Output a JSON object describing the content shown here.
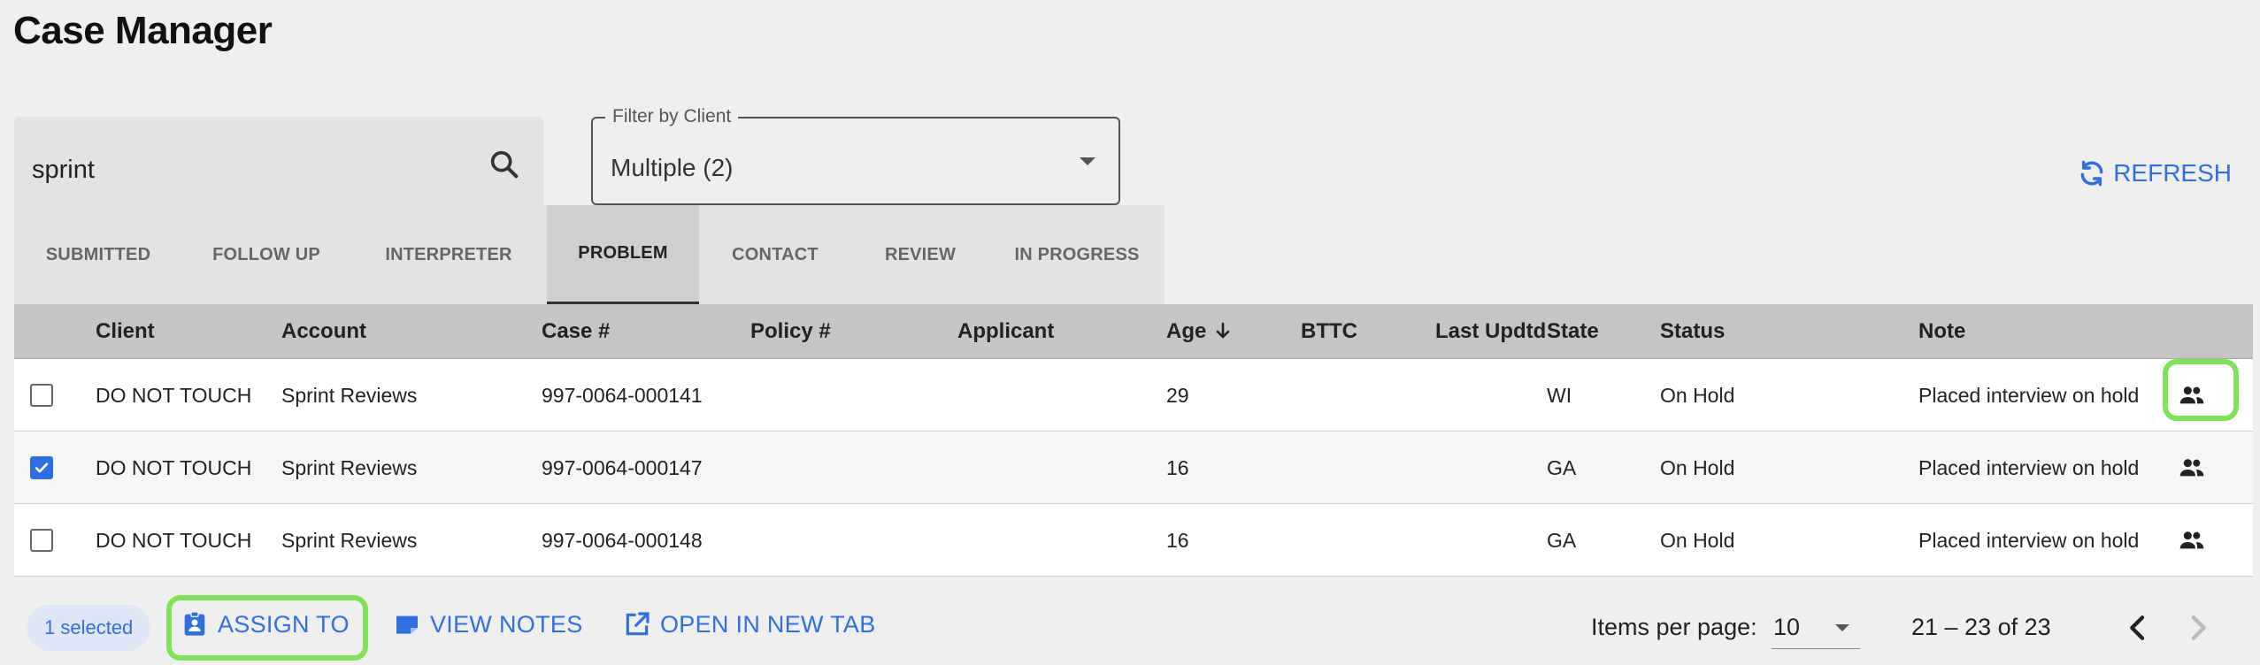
{
  "page": {
    "title": "Case Manager"
  },
  "search": {
    "value": "sprint",
    "placeholder": ""
  },
  "filter": {
    "label": "Filter by Client",
    "value": "Multiple (2)"
  },
  "refresh": {
    "label": "REFRESH"
  },
  "tabs": [
    {
      "label": "SUBMITTED",
      "active": false
    },
    {
      "label": "FOLLOW UP",
      "active": false
    },
    {
      "label": "INTERPRETER",
      "active": false
    },
    {
      "label": "PROBLEM",
      "active": true
    },
    {
      "label": "CONTACT",
      "active": false
    },
    {
      "label": "REVIEW",
      "active": false
    },
    {
      "label": "IN PROGRESS",
      "active": false
    }
  ],
  "table": {
    "columns": {
      "client": "Client",
      "account": "Account",
      "case": "Case #",
      "policy": "Policy #",
      "applicant": "Applicant",
      "age": "Age",
      "bttc": "BTTC",
      "last_updtd": "Last Updtd",
      "state": "State",
      "status": "Status",
      "note": "Note"
    },
    "rows": [
      {
        "checked": false,
        "client": "DO NOT TOUCH",
        "account": "Sprint Reviews",
        "case": "997-0064-000141",
        "policy": "",
        "applicant": "",
        "age": "29",
        "bttc": "",
        "last_updtd": "",
        "state": "WI",
        "status": "On Hold",
        "note": "Placed interview on hold"
      },
      {
        "checked": true,
        "client": "DO NOT TOUCH",
        "account": "Sprint Reviews",
        "case": "997-0064-000147",
        "policy": "",
        "applicant": "",
        "age": "16",
        "bttc": "",
        "last_updtd": "",
        "state": "GA",
        "status": "On Hold",
        "note": "Placed interview on hold"
      },
      {
        "checked": false,
        "client": "DO NOT TOUCH",
        "account": "Sprint Reviews",
        "case": "997-0064-000148",
        "policy": "",
        "applicant": "",
        "age": "16",
        "bttc": "",
        "last_updtd": "",
        "state": "GA",
        "status": "On Hold",
        "note": "Placed interview on hold"
      }
    ]
  },
  "footer": {
    "selected": "1 selected",
    "assign_label": "ASSIGN TO",
    "view_notes_label": "VIEW NOTES",
    "open_tab_label": "OPEN IN NEW TAB",
    "items_per_page_label": "Items per page:",
    "items_per_page_value": "10",
    "range": "21 – 23 of 23"
  },
  "colors": {
    "accent": "#2f6fe0",
    "highlight": "#7fe35a"
  },
  "icons": {
    "search": "search-icon",
    "refresh": "refresh-icon",
    "people": "people-icon",
    "assign": "assign-icon",
    "notes": "notes-icon",
    "open": "open-new-tab-icon",
    "prev": "chevron-left-icon",
    "next": "chevron-right-icon",
    "sort": "arrow-down-icon"
  }
}
